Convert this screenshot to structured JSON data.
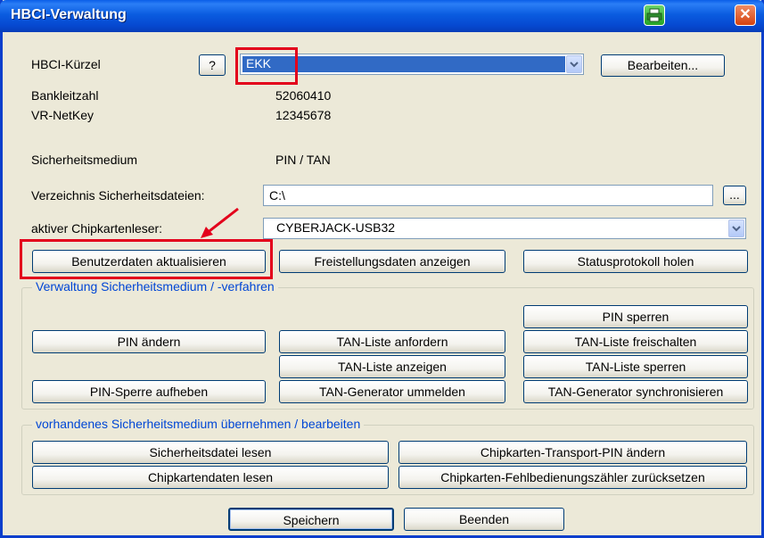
{
  "window": {
    "title": "HBCI-Verwaltung",
    "close_glyph": "✕"
  },
  "form": {
    "kuerzel_label": "HBCI-Kürzel",
    "help_label": "?",
    "kuerzel_value": "EKK",
    "edit_label": "Bearbeiten...",
    "blz_label": "Bankleitzahl",
    "blz_value": "52060410",
    "netkey_label": "VR-NetKey",
    "netkey_value": "12345678",
    "medium_label": "Sicherheitsmedium",
    "medium_value": "PIN / TAN",
    "dir_label": "Verzeichnis Sicherheitsdateien:",
    "dir_value": "C:\\",
    "browse_label": "...",
    "reader_label": "aktiver Chipkartenleser:",
    "reader_value": "CYBERJACK-USB32"
  },
  "top_buttons": {
    "update_user": "Benutzerdaten aktualisieren",
    "show_exemption": "Freistellungsdaten anzeigen",
    "get_status": "Statusprotokoll holen"
  },
  "group1": {
    "title": "Verwaltung Sicherheitsmedium / -verfahren",
    "pin_lock": "PIN sperren",
    "pin_change": "PIN ändern",
    "tan_request": "TAN-Liste anfordern",
    "tan_unlock": "TAN-Liste freischalten",
    "tan_show": "TAN-Liste anzeigen",
    "tan_lock": "TAN-Liste sperren",
    "pin_unblock": "PIN-Sperre aufheben",
    "tan_gen_reregister": "TAN-Generator ummelden",
    "tan_gen_sync": "TAN-Generator synchronisieren"
  },
  "group2": {
    "title": "vorhandenes Sicherheitsmedium übernehmen / bearbeiten",
    "read_file": "Sicherheitsdatei lesen",
    "change_transport_pin": "Chipkarten-Transport-PIN ändern",
    "read_chipcard": "Chipkartendaten lesen",
    "reset_error_counter": "Chipkarten-Fehlbedienungszähler zurücksetzen"
  },
  "bottom": {
    "save": "Speichern",
    "close": "Beenden"
  },
  "colors": {
    "highlight_red": "#e3001b",
    "selection_blue": "#316ac5",
    "group_title_blue": "#0046d5"
  },
  "icons": [
    "printer-icon",
    "close-icon",
    "chevron-down-icon"
  ]
}
